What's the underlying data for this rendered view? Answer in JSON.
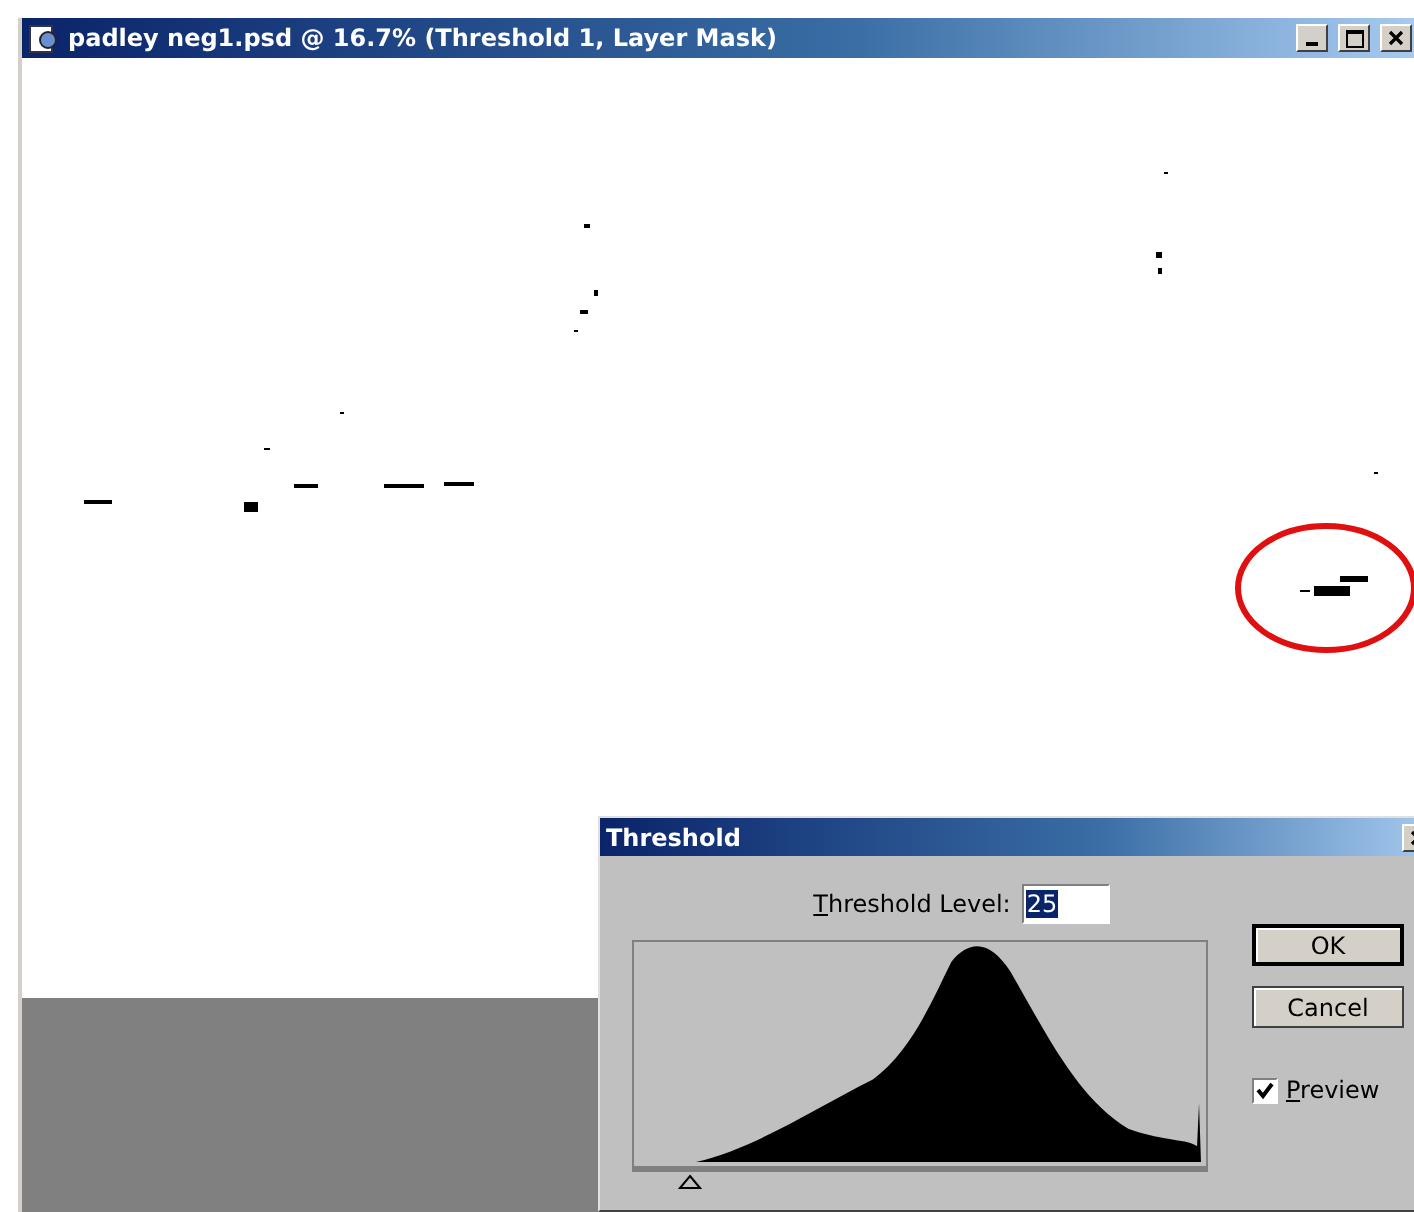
{
  "window": {
    "title": "padley neg1.psd @ 16.7% (Threshold 1, Layer Mask)"
  },
  "dialog": {
    "title": "Threshold",
    "threshold_label": "Threshold Level:",
    "threshold_value": "25",
    "value_selected": true,
    "slider": {
      "level": 0.1
    },
    "buttons": [
      {
        "label": "OK",
        "default": true
      },
      {
        "label": "Cancel",
        "default": false
      }
    ],
    "preview": {
      "label": "Preview",
      "checked": true
    }
  }
}
